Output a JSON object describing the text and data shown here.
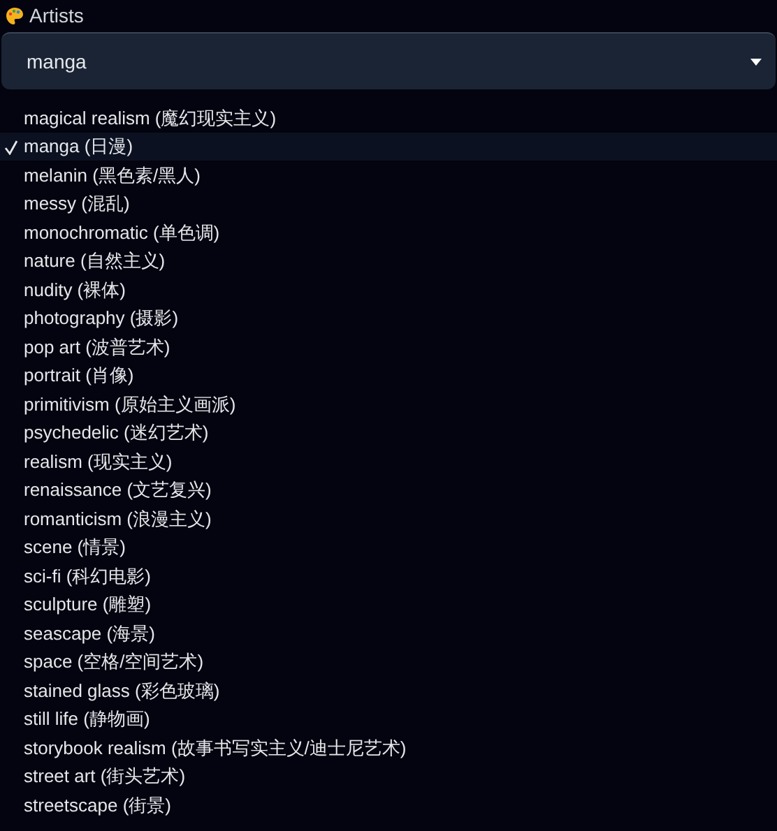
{
  "field": {
    "label": "Artists",
    "value": "manga"
  },
  "options": [
    {
      "label": "magical realism (魔幻现实主义)",
      "selected": false
    },
    {
      "label": "manga (日漫)",
      "selected": true
    },
    {
      "label": "melanin (黑色素/黑人)",
      "selected": false
    },
    {
      "label": "messy (混乱)",
      "selected": false
    },
    {
      "label": "monochromatic (单色调)",
      "selected": false
    },
    {
      "label": "nature (自然主义)",
      "selected": false
    },
    {
      "label": "nudity (裸体)",
      "selected": false
    },
    {
      "label": "photography (摄影)",
      "selected": false
    },
    {
      "label": "pop art (波普艺术)",
      "selected": false
    },
    {
      "label": "portrait (肖像)",
      "selected": false
    },
    {
      "label": "primitivism (原始主义画派)",
      "selected": false
    },
    {
      "label": "psychedelic (迷幻艺术)",
      "selected": false
    },
    {
      "label": "realism (现实主义)",
      "selected": false
    },
    {
      "label": "renaissance (文艺复兴)",
      "selected": false
    },
    {
      "label": "romanticism (浪漫主义)",
      "selected": false
    },
    {
      "label": "scene (情景)",
      "selected": false
    },
    {
      "label": "sci-fi (科幻电影)",
      "selected": false
    },
    {
      "label": "sculpture (雕塑)",
      "selected": false
    },
    {
      "label": "seascape (海景)",
      "selected": false
    },
    {
      "label": "space (空格/空间艺术)",
      "selected": false
    },
    {
      "label": "stained glass (彩色玻璃)",
      "selected": false
    },
    {
      "label": "still life (静物画)",
      "selected": false
    },
    {
      "label": "storybook realism (故事书写实主义/迪士尼艺术)",
      "selected": false
    },
    {
      "label": "street art (街头艺术)",
      "selected": false
    },
    {
      "label": "streetscape (街景)",
      "selected": false
    }
  ]
}
